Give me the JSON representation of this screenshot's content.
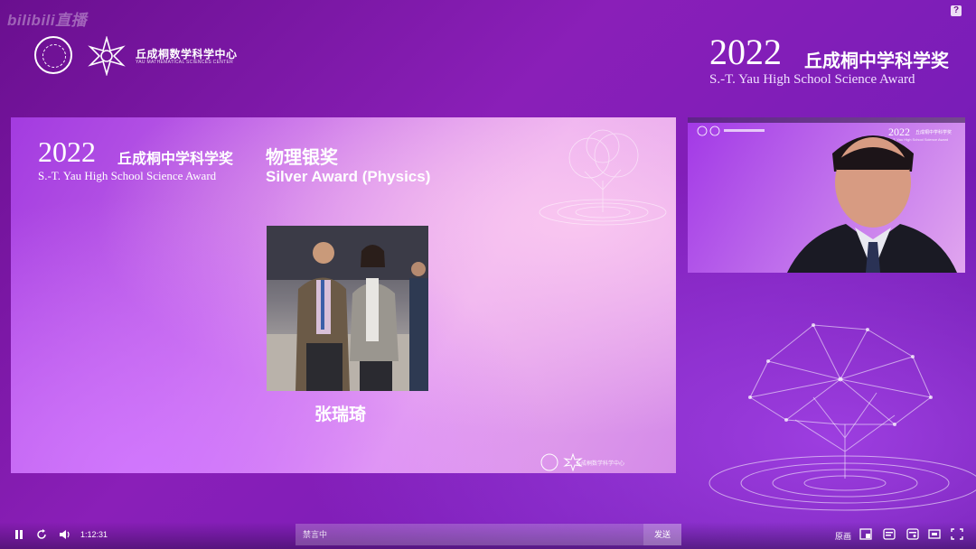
{
  "watermark": {
    "text": "bilibili直播"
  },
  "header": {
    "center_name_cn": "丘成桐数学科学中心",
    "center_name_en": "YAU MATHEMATICAL SCIENCES CENTER",
    "year": "2022",
    "title_cn": "丘成桐中学科学奖",
    "title_en": "S.-T. Yau High School Science Award"
  },
  "slide": {
    "year": "2022",
    "title_cn": "丘成桐中学科学奖",
    "title_en": "S.-T. Yau High School Science Award",
    "award_cn": "物理银奖",
    "award_en": "Silver Award (Physics)",
    "winner_name": "张瑞琦",
    "footer_center": "丘成桐数学科学中心"
  },
  "camera": {
    "year": "2022",
    "title_cn": "丘成桐中学科学奖",
    "title_en": "S.-T. Yau High School Science Award"
  },
  "controls": {
    "time": "1:12:31",
    "chat_placeholder": "禁言中",
    "send_label": "发送",
    "original_label": "原画",
    "icons": [
      "pause-icon",
      "refresh-icon",
      "volume-icon",
      "pip-icon",
      "danmaku-icon",
      "danmaku-settings-icon",
      "widescreen-icon",
      "fullscreen-icon"
    ]
  },
  "colors": {
    "bg_top": "#6a0f8f",
    "bg_accent": "#9d3ee0",
    "slide_light": "#e8a8ef"
  }
}
